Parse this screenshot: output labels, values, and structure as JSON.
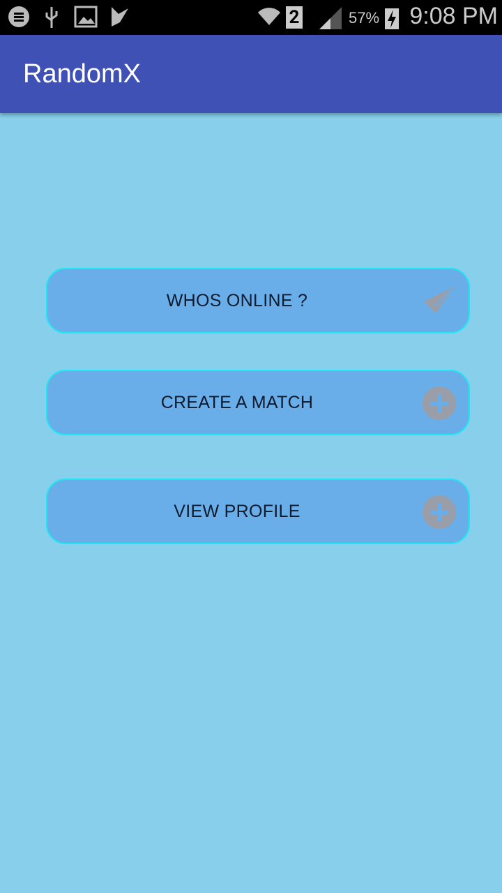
{
  "status_bar": {
    "time": "9:08 PM",
    "battery": "57%",
    "sim": "2",
    "icons": [
      "messenger-icon",
      "usb-icon",
      "image-icon",
      "check-icon",
      "wifi-icon",
      "sim-icon",
      "signal-icon",
      "battery-charging-icon"
    ]
  },
  "app_bar": {
    "title": "RandomX"
  },
  "buttons": [
    {
      "label": "WHOS ONLINE ?",
      "icon": "paper-plane-icon"
    },
    {
      "label": "CREATE A MATCH",
      "icon": "plus-circle-icon"
    },
    {
      "label": "VIEW PROFILE",
      "icon": "plus-circle-icon"
    }
  ],
  "colors": {
    "background": "#87CFEB",
    "app_bar": "#3F51B5",
    "button": "#6AAEE9",
    "button_border": "#1EE6F5"
  }
}
